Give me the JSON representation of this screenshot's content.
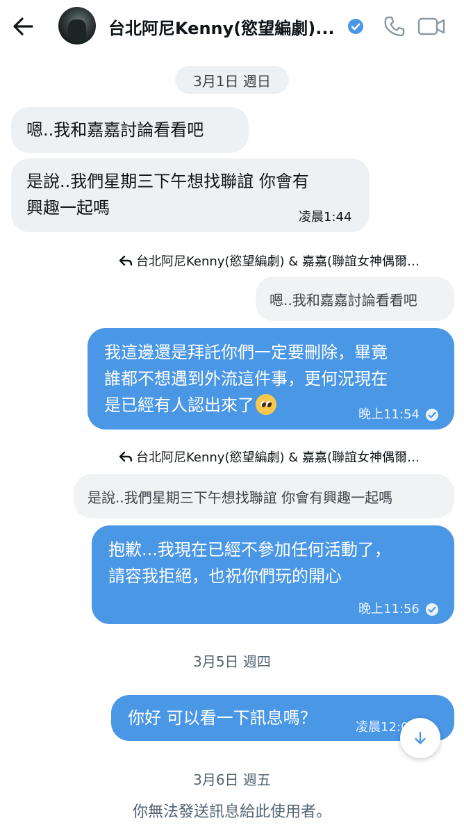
{
  "header": {
    "title": "台北阿尼Kenny(慾望編劇)...",
    "icons": [
      "back-arrow-icon",
      "verified-badge-icon",
      "phone-icon",
      "video-call-icon"
    ],
    "accent_color": "#4a97e6"
  },
  "messages": {
    "date1": "3月1日 週日",
    "in1": "嗯..我和嘉嘉討論看看吧",
    "in2_line1": "是說..我們星期三下午想找聯誼 你會有",
    "in2_line2": "興趣一起嗎",
    "in2_time": "凌晨1:44",
    "reply1_label": "台北阿尼Kenny(慾望編劇) & 嘉嘉(聯誼女神偶爾…",
    "quote1": "嗯..我和嘉嘉討論看看吧",
    "out1_line1": "我這邊還是拜託你們一定要刪除，畢竟",
    "out1_line2": "誰都不想遇到外流這件事，更何況現在",
    "out1_line3": "是已經有人認出來了",
    "out1_time": "晚上11:54",
    "reply2_label": "台北阿尼Kenny(慾望編劇) & 嘉嘉(聯誼女神偶爾…",
    "quote2": "是說..我們星期三下午想找聯誼 你會有興趣一起嗎",
    "out2_line1": "抱歉...我現在已經不參加任何活動了，",
    "out2_line2": "請容我拒絕，也祝你們玩的開心",
    "out2_time": "晚上11:56",
    "date2": "3月5日 週四",
    "out3": "你好 可以看一下訊息嗎？",
    "out3_time": "凌晨12:0",
    "date3": "3月6日 週五"
  },
  "footer": {
    "note": "你無法發送訊息給此使用者。"
  }
}
